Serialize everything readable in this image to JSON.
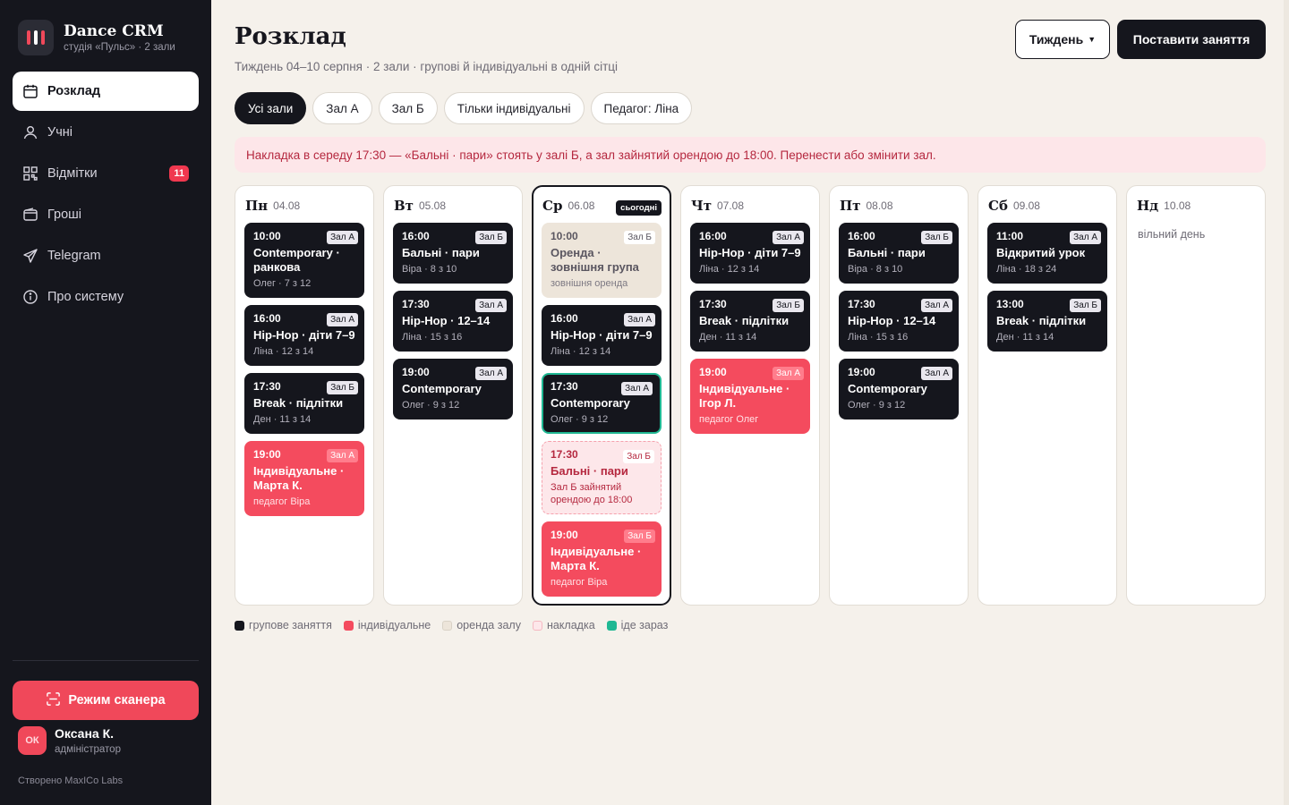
{
  "brand": {
    "name": "Dance CRM",
    "subtitle": "студія «Пульс» · 2 зали"
  },
  "nav": [
    {
      "label": "Розклад",
      "icon": "calendar-icon",
      "active": true
    },
    {
      "label": "Учні",
      "icon": "user-icon"
    },
    {
      "label": "Відмітки",
      "icon": "qr-code-icon",
      "badge": "11"
    },
    {
      "label": "Гроші",
      "icon": "wallet-icon"
    },
    {
      "label": "Telegram",
      "icon": "send-icon"
    },
    {
      "label": "Про систему",
      "icon": "info-icon"
    }
  ],
  "scanner_button": "Режим сканера",
  "user": {
    "initials": "ОК",
    "name": "Оксана К.",
    "role": "адміністратор"
  },
  "credit": "Створено MaxICo Labs",
  "header": {
    "title": "Розклад",
    "subtitle": "Тиждень 04–10 серпня · 2 зали · групові й індивідуальні в одній сітці",
    "week_button": "Тиждень",
    "primary_button": "Поставити заняття"
  },
  "filters": [
    "Усі зали",
    "Зал А",
    "Зал Б",
    "Тільки індивідуальні",
    "Педагог: Ліна"
  ],
  "alert": "Накладка в середу 17:30 — «Бальні · пари» стоять у залі Б, а зал зайнятий орендою до 18:00. Перенести або змінити зал.",
  "today_label": "сьогодні",
  "free_day_label": "вільний день",
  "days": [
    {
      "name": "Пн",
      "date": "04.08",
      "sessions": [
        {
          "time": "10:00",
          "hall": "Зал А",
          "title": "Contemporary · ранкова",
          "meta": "Олег · 7 з 12",
          "kind": "group"
        },
        {
          "time": "16:00",
          "hall": "Зал А",
          "title": "Hip-Hop · діти 7–9",
          "meta": "Ліна · 12 з 14",
          "kind": "group"
        },
        {
          "time": "17:30",
          "hall": "Зал Б",
          "title": "Break · підлітки",
          "meta": "Ден · 11 з 14",
          "kind": "group"
        },
        {
          "time": "19:00",
          "hall": "Зал А",
          "title": "Індивідуальне · Марта К.",
          "meta": "педагог Віра",
          "kind": "indiv"
        }
      ]
    },
    {
      "name": "Вт",
      "date": "05.08",
      "sessions": [
        {
          "time": "16:00",
          "hall": "Зал Б",
          "title": "Бальні · пари",
          "meta": "Віра · 8 з 10",
          "kind": "group"
        },
        {
          "time": "17:30",
          "hall": "Зал А",
          "title": "Hip-Hop · 12–14",
          "meta": "Ліна · 15 з 16",
          "kind": "group"
        },
        {
          "time": "19:00",
          "hall": "Зал А",
          "title": "Contemporary",
          "meta": "Олег · 9 з 12",
          "kind": "group"
        }
      ]
    },
    {
      "name": "Ср",
      "date": "06.08",
      "today": true,
      "sessions": [
        {
          "time": "10:00",
          "hall": "Зал Б",
          "title": "Оренда · зовнішня група",
          "meta": "зовнішня оренда",
          "kind": "rent"
        },
        {
          "time": "16:00",
          "hall": "Зал А",
          "title": "Hip-Hop · діти 7–9",
          "meta": "Ліна · 12 з 14",
          "kind": "group"
        },
        {
          "time": "17:30",
          "hall": "Зал А",
          "title": "Contemporary",
          "meta": "Олег · 9 з 12",
          "kind": "now"
        },
        {
          "time": "17:30",
          "hall": "Зал Б",
          "title": "Бальні · пари",
          "meta": "Зал Б зайнятий орендою до 18:00",
          "kind": "conflict"
        },
        {
          "time": "19:00",
          "hall": "Зал Б",
          "title": "Індивідуальне · Марта К.",
          "meta": "педагог Віра",
          "kind": "indiv"
        }
      ]
    },
    {
      "name": "Чт",
      "date": "07.08",
      "sessions": [
        {
          "time": "16:00",
          "hall": "Зал А",
          "title": "Hip-Hop · діти 7–9",
          "meta": "Ліна · 12 з 14",
          "kind": "group"
        },
        {
          "time": "17:30",
          "hall": "Зал Б",
          "title": "Break · підлітки",
          "meta": "Ден · 11 з 14",
          "kind": "group"
        },
        {
          "time": "19:00",
          "hall": "Зал А",
          "title": "Індивідуальне · Ігор Л.",
          "meta": "педагог Олег",
          "kind": "indiv"
        }
      ]
    },
    {
      "name": "Пт",
      "date": "08.08",
      "sessions": [
        {
          "time": "16:00",
          "hall": "Зал Б",
          "title": "Бальні · пари",
          "meta": "Віра · 8 з 10",
          "kind": "group"
        },
        {
          "time": "17:30",
          "hall": "Зал А",
          "title": "Hip-Hop · 12–14",
          "meta": "Ліна · 15 з 16",
          "kind": "group"
        },
        {
          "time": "19:00",
          "hall": "Зал А",
          "title": "Contemporary",
          "meta": "Олег · 9 з 12",
          "kind": "group"
        }
      ]
    },
    {
      "name": "Сб",
      "date": "09.08",
      "sessions": [
        {
          "time": "11:00",
          "hall": "Зал А",
          "title": "Відкритий урок",
          "meta": "Ліна · 18 з 24",
          "kind": "group"
        },
        {
          "time": "13:00",
          "hall": "Зал Б",
          "title": "Break · підлітки",
          "meta": "Ден · 11 з 14",
          "kind": "group"
        }
      ]
    },
    {
      "name": "Нд",
      "date": "10.08",
      "sessions": []
    }
  ],
  "legend": [
    {
      "label": "групове заняття",
      "color": "#15161d"
    },
    {
      "label": "індивідуальне",
      "color": "#f44b5e"
    },
    {
      "label": "оренда залу",
      "color": "#ede5da"
    },
    {
      "label": "накладка",
      "color": "#fde7ea"
    },
    {
      "label": "іде зараз",
      "color": "#1fb893"
    }
  ],
  "colors": {
    "accent": "#f0485a",
    "now": "#1fb893",
    "dark": "#15161d"
  }
}
